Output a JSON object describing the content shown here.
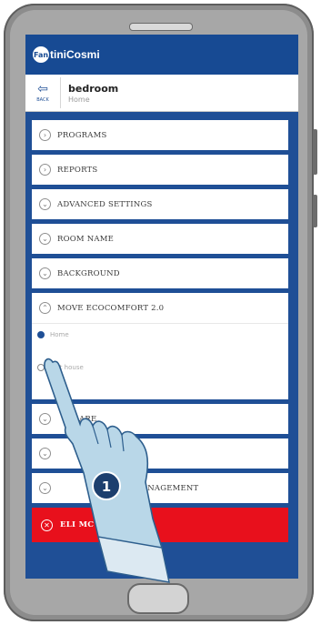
{
  "app": {
    "brand": "FantiniCosmi",
    "logo_short": "Fan"
  },
  "header": {
    "back_label": "BACK",
    "title": "bedroom",
    "subtitle": "Home"
  },
  "menu": {
    "items": [
      {
        "label": "PROGRAMS"
      },
      {
        "label": "REPORTS"
      },
      {
        "label": "ADVANCED SETTINGS"
      },
      {
        "label": "ROOM NAME"
      },
      {
        "label": "BACKGROUND"
      }
    ],
    "expanded": {
      "label": "MOVE ECOCOMFORT 2.0",
      "options": [
        {
          "label": "Home",
          "selected": true
        },
        {
          "label": "test house",
          "selected": false
        }
      ]
    },
    "after": [
      {
        "label": "ARE"
      },
      {
        "label": ""
      },
      {
        "label": "MANAGEMENT"
      }
    ],
    "delete_label": "ELI MC"
  },
  "overlay": {
    "step": "1"
  },
  "colors": {
    "screen_bg": "#1f4f96",
    "brand_bar": "#174a93",
    "delete": "#e8101c",
    "hand": "#b9d7e8"
  }
}
